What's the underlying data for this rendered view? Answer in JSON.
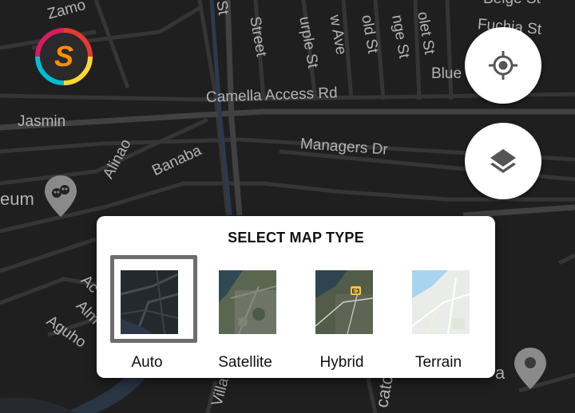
{
  "map": {
    "street_labels": [
      {
        "text": "Zamo",
        "rot": -15
      },
      {
        "text": "St",
        "rot": 80
      },
      {
        "text": "Street",
        "rot": 80
      },
      {
        "text": "urple St",
        "rot": 80
      },
      {
        "text": "w Ave",
        "rot": 80
      },
      {
        "text": "old St",
        "rot": 80
      },
      {
        "text": "nge St",
        "rot": 80
      },
      {
        "text": "olet St",
        "rot": 80
      },
      {
        "text": "Beige St",
        "rot": 0
      },
      {
        "text": "Fuchia St",
        "rot": 5
      },
      {
        "text": "Blue",
        "rot": 0
      },
      {
        "text": "Camella Access Rd",
        "rot": -2
      },
      {
        "text": "Jasmin",
        "rot": 0
      },
      {
        "text": "Managers Dr",
        "rot": 4
      },
      {
        "text": "Alinao",
        "rot": -62
      },
      {
        "text": "Banaba",
        "rot": -25
      },
      {
        "text": "eum",
        "rot": 0
      },
      {
        "text": "Ac",
        "rot": 45
      },
      {
        "text": "Alm",
        "rot": 45
      },
      {
        "text": "Aguho",
        "rot": 35
      },
      {
        "text": "Villa",
        "rot": -75
      },
      {
        "text": "catc",
        "rot": -80
      },
      {
        "text": "a",
        "rot": 0
      }
    ],
    "colors": {
      "background": "#1f1f1f",
      "road": "#3a3a3a",
      "major_road": "#444444",
      "water": "#2a3544",
      "label": "#b3b3b3"
    }
  },
  "controls": {
    "locate_icon": "crosshair-icon",
    "layers_icon": "layers-icon"
  },
  "logo": {
    "letter": "S",
    "icon": "app-logo-icon"
  },
  "dialog": {
    "title": "SELECT MAP TYPE",
    "options": [
      {
        "label": "Auto",
        "selected": true,
        "icon": "auto-map-thumbnail"
      },
      {
        "label": "Satellite",
        "selected": false,
        "icon": "satellite-map-thumbnail"
      },
      {
        "label": "Hybrid",
        "selected": false,
        "icon": "hybrid-map-thumbnail",
        "badge": "E3"
      },
      {
        "label": "Terrain",
        "selected": false,
        "icon": "terrain-map-thumbnail"
      }
    ]
  }
}
